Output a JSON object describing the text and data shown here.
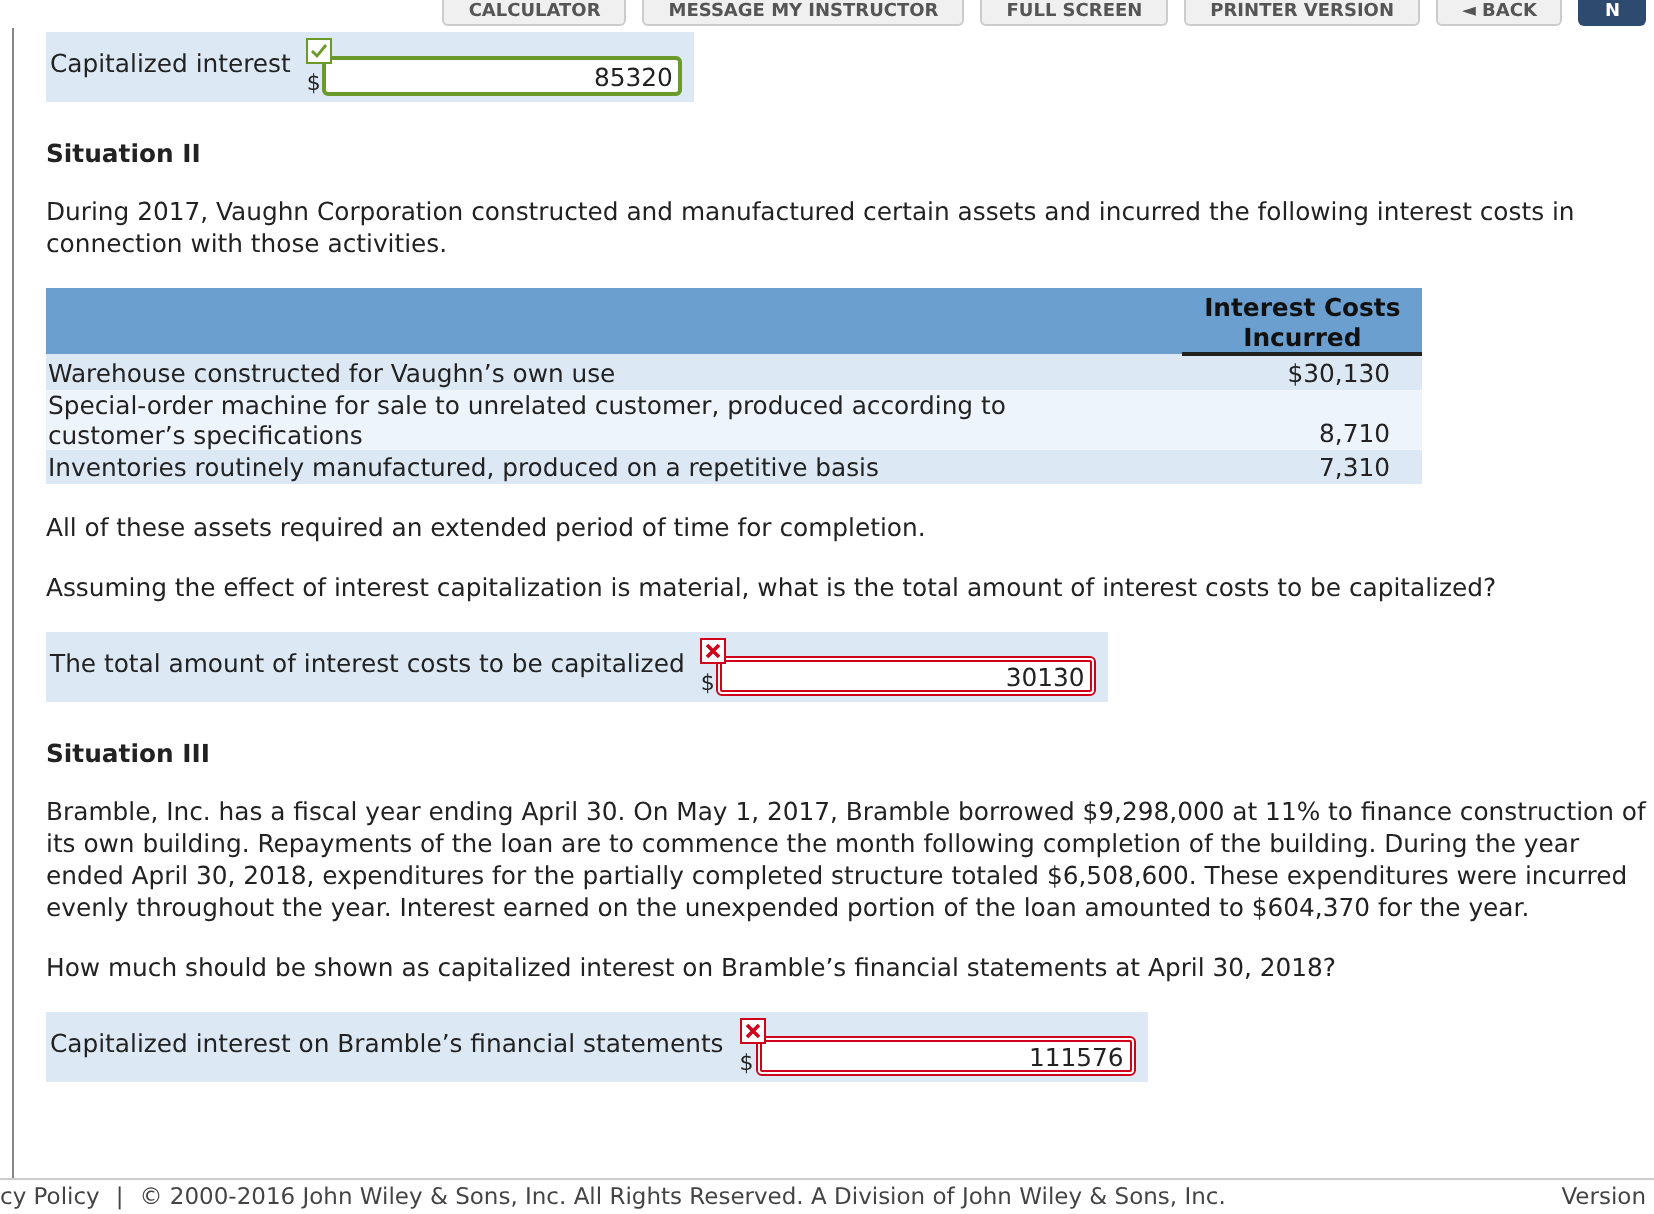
{
  "toolbar": {
    "buttons": [
      {
        "label": "CALCULATOR",
        "kind": "plain"
      },
      {
        "label": "MESSAGE MY INSTRUCTOR",
        "kind": "plain"
      },
      {
        "label": "FULL SCREEN",
        "kind": "plain"
      },
      {
        "label": "PRINTER VERSION",
        "kind": "plain"
      },
      {
        "label": "◄ BACK",
        "kind": "plain"
      },
      {
        "label": "N",
        "kind": "primary"
      }
    ]
  },
  "sections": [
    {
      "kind": "answer",
      "label": "Capitalized interest",
      "currency": "$",
      "value": "85320",
      "correct": true
    },
    {
      "kind": "heading",
      "text": "Situation II"
    },
    {
      "kind": "paragraph",
      "text": "During 2017, Vaughn Corporation constructed and manufactured certain assets and incurred the following interest costs in connection with those activities."
    },
    {
      "kind": "table",
      "header": "Interest Costs Incurred",
      "rows": [
        {
          "label": "Warehouse constructed for Vaughn’s own use",
          "amount": "$30,130"
        },
        {
          "label": "Special-order machine for sale to unrelated customer, produced according to customer’s specifications",
          "amount": "8,710"
        },
        {
          "label": "Inventories routinely manufactured, produced on a repetitive basis",
          "amount": "7,310"
        }
      ]
    },
    {
      "kind": "paragraph",
      "text": "All of these assets required an extended period of time for completion."
    },
    {
      "kind": "paragraph",
      "text": "Assuming the effect of interest capitalization is material, what is the total amount of interest costs to be capitalized?"
    },
    {
      "kind": "answer",
      "label": "The total amount of interest costs to be capitalized",
      "currency": "$",
      "value": "30130",
      "correct": false
    },
    {
      "kind": "heading",
      "text": "Situation III"
    },
    {
      "kind": "paragraph",
      "text": "Bramble, Inc. has a fiscal year ending April 30. On May 1, 2017, Bramble borrowed $9,298,000 at 11% to finance construction of its own building. Repayments of the loan are to commence the month following completion of the building. During the year ended April 30, 2018, expenditures for the partially completed structure totaled $6,508,600. These expenditures were incurred evenly throughout the year. Interest earned on the unexpended portion of the loan amounted to $604,370 for the year."
    },
    {
      "kind": "paragraph",
      "text": "How much should be shown as capitalized interest on Bramble’s financial statements at April 30, 2018?"
    },
    {
      "kind": "answer",
      "label": "Capitalized interest on Bramble’s financial statements",
      "currency": "$",
      "value": "111576",
      "correct": false
    }
  ],
  "footer": {
    "left": "cy Policy",
    "separator": "|",
    "copyright": "© 2000-2016 John Wiley & Sons, Inc. All Rights Reserved. A Division of John Wiley & Sons, Inc.",
    "right": "Version"
  }
}
